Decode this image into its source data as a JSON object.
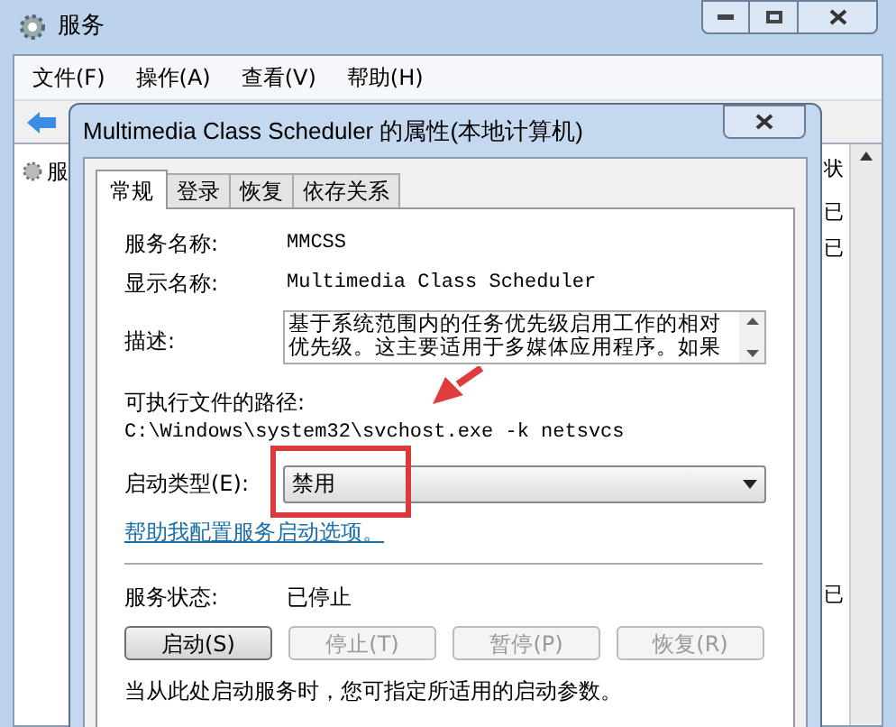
{
  "window": {
    "title": "服务"
  },
  "menu": [
    "文件(F)",
    "操作(A)",
    "查看(V)",
    "帮助(H)"
  ],
  "background_list": {
    "header_left": "服",
    "header_right": "状",
    "cells": [
      "已",
      "已",
      "已"
    ]
  },
  "dialog": {
    "title": "Multimedia Class Scheduler 的属性(本地计算机)",
    "tabs": [
      {
        "label": "常规",
        "selected": true
      },
      {
        "label": "登录",
        "selected": false
      },
      {
        "label": "恢复",
        "selected": false
      },
      {
        "label": "依存关系",
        "selected": false
      }
    ],
    "service_name": {
      "label": "服务名称:",
      "value": "MMCSS"
    },
    "display_name": {
      "label": "显示名称:",
      "value": "Multimedia Class Scheduler"
    },
    "description": {
      "label": "描述:",
      "value": "基于系统范围内的任务优先级启用工作的相对优先级。这主要适用于多媒体应用程序。如果"
    },
    "path": {
      "label": "可执行文件的路径:",
      "value": "C:\\Windows\\system32\\svchost.exe -k netsvcs"
    },
    "startup_type": {
      "label": "启动类型(E):",
      "value": "禁用"
    },
    "help_link": "帮助我配置服务启动选项。",
    "status": {
      "label": "服务状态:",
      "value": "已停止"
    },
    "buttons": [
      {
        "label": "启动(S)",
        "disabled": false
      },
      {
        "label": "停止(T)",
        "disabled": true
      },
      {
        "label": "暂停(P)",
        "disabled": true
      },
      {
        "label": "恢复(R)",
        "disabled": true
      }
    ],
    "note": "当从此处启动服务时，您可指定所适用的启动参数。"
  }
}
